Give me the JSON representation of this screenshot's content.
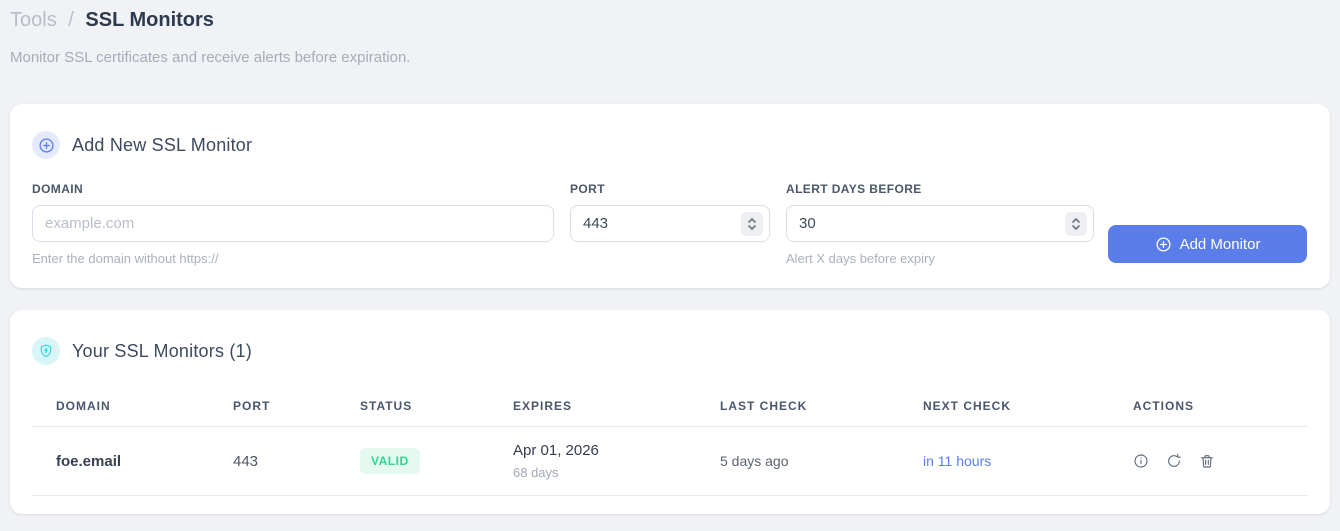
{
  "page": {
    "breadcrumb": {
      "parent": "Tools",
      "separator": "/",
      "current": "SSL Monitors"
    },
    "subtitle": "Monitor SSL certificates and receive alerts before expiration."
  },
  "add_form": {
    "title": "Add New SSL Monitor",
    "fields": {
      "domain": {
        "label": "DOMAIN",
        "placeholder": "example.com",
        "value": "",
        "helper": "Enter the domain without https://"
      },
      "port": {
        "label": "PORT",
        "value": "443"
      },
      "alert_days": {
        "label": "ALERT DAYS BEFORE",
        "value": "30",
        "helper": "Alert X days before expiry"
      }
    },
    "submit_label": "Add Monitor"
  },
  "monitors": {
    "title": "Your SSL Monitors (1)",
    "count": "1",
    "table": {
      "headers": [
        "DOMAIN",
        "PORT",
        "STATUS",
        "EXPIRES",
        "LAST CHECK",
        "NEXT CHECK",
        "ACTIONS"
      ],
      "rows": [
        {
          "domain": "foe.email",
          "port": "443",
          "status": "VALID",
          "expires_date": "Apr 01, 2026",
          "expires_days": "68 days",
          "last_check": "5 days ago",
          "next_check": "in 11 hours"
        }
      ]
    }
  },
  "icons": {
    "form_header": "plus-circle-icon",
    "monitors_header": "shield-keyhole-icon",
    "button": "plus-circle-icon",
    "row_actions": [
      "info-icon",
      "refresh-icon",
      "trash-icon"
    ]
  },
  "colors": {
    "primary_blue": "#5a7de9",
    "valid_green_text": "#35d493",
    "valid_green_bg": "#e4f9ef",
    "shield_cyan": "#3cd3e2",
    "page_bg": "#f0f2f5",
    "card_bg": "#ffffff"
  }
}
